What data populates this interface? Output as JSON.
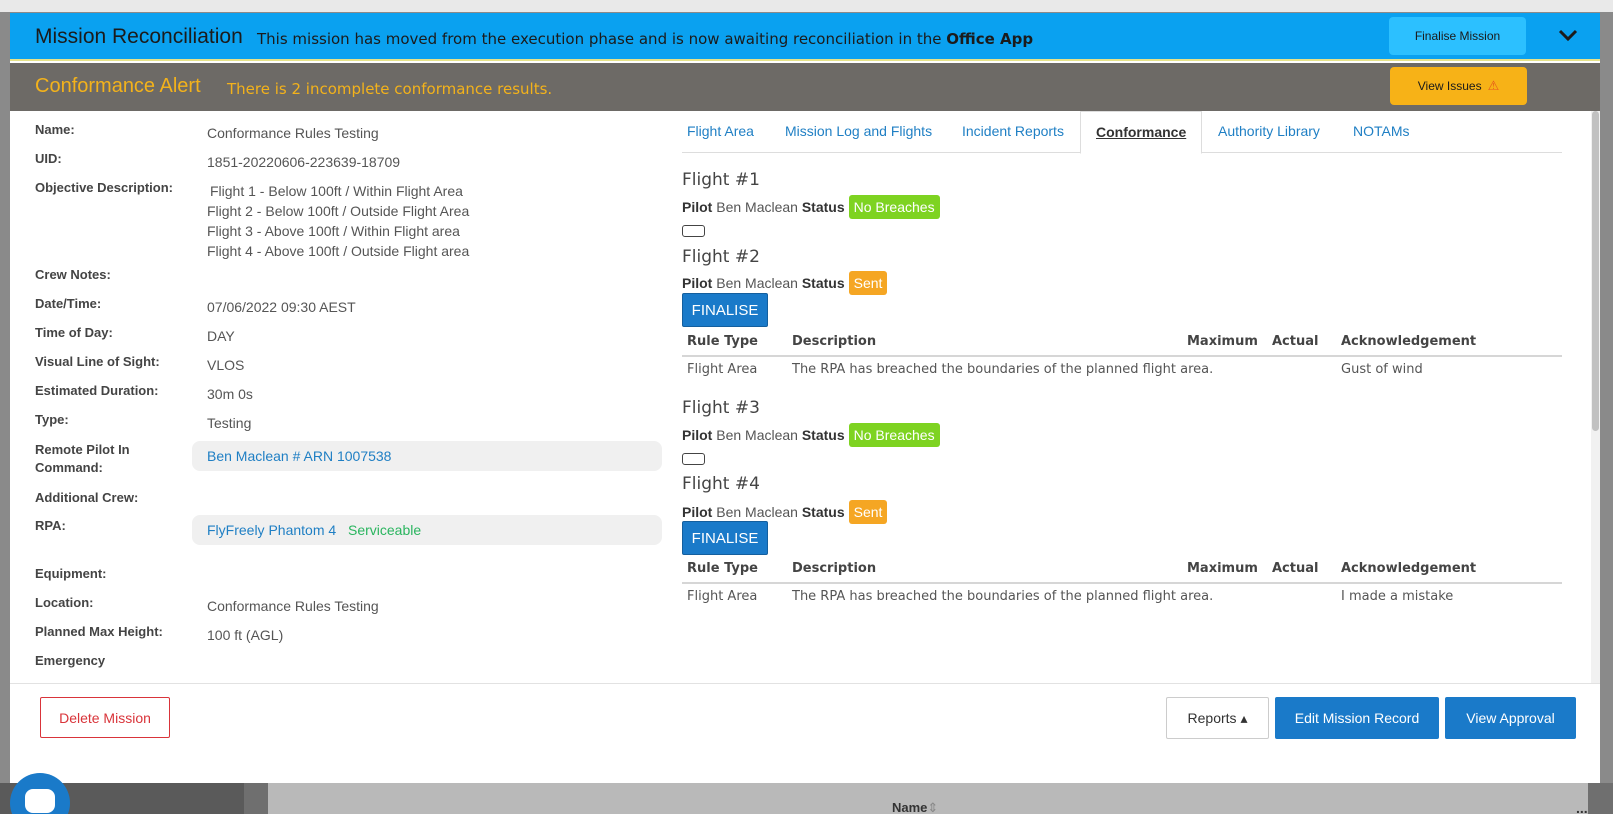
{
  "header": {
    "title": "Mission Reconciliation",
    "message_prefix": "This mission has moved from the execution phase and is now awaiting reconciliation in the ",
    "message_bold": "Office App",
    "finalise_label": "Finalise Mission"
  },
  "alert": {
    "title": "Conformance Alert",
    "message": "There is 2 incomplete conformance results.",
    "button_label": "View Issues",
    "warn_icon": "⚠"
  },
  "details": {
    "name_label": "Name:",
    "name_value": "Conformance Rules Testing",
    "uid_label": "UID:",
    "uid_value": "1851-20220606-223639-18709",
    "objective_label": "Objective Description:",
    "objective_lines": [
      "Flight 1 - Below 100ft / Within Flight Area",
      "Flight 2 - Below 100ft / Outside Flight Area",
      "Flight 3 - Above 100ft / Within Flight area",
      "Flight 4 - Above 100ft / Outside Flight area"
    ],
    "crew_notes_label": "Crew Notes:",
    "datetime_label": "Date/Time:",
    "datetime_value": "07/06/2022 09:30 AEST",
    "timeofday_label": "Time of Day:",
    "timeofday_value": "DAY",
    "vlos_label": "Visual Line of Sight:",
    "vlos_value": "VLOS",
    "duration_label": "Estimated Duration:",
    "duration_value": "30m 0s",
    "type_label": "Type:",
    "type_value": "Testing",
    "rpic_label": "Remote Pilot In Command:",
    "rpic_value": "Ben Maclean # ARN 1007538",
    "additional_crew_label": "Additional Crew:",
    "rpa_label": "RPA:",
    "rpa_name": "FlyFreely Phantom 4",
    "rpa_status": "Serviceable",
    "equipment_label": "Equipment:",
    "location_label": "Location:",
    "location_value": "Conformance Rules Testing",
    "maxheight_label": "Planned Max Height:",
    "maxheight_value": "100 ft (AGL)",
    "emergency_label": "Emergency"
  },
  "tabs": [
    "Flight Area",
    "Mission Log and Flights",
    "Incident Reports",
    "Conformance",
    "Authority Library",
    "NOTAMs"
  ],
  "conformance": {
    "pilot_label": "Pilot",
    "status_label": "Status",
    "finalise_label": "FINALISE",
    "columns": [
      "Rule Type",
      "Description",
      "Maximum",
      "Actual",
      "Acknowledgement"
    ],
    "flights": [
      {
        "title": "Flight #1",
        "pilot": "Ben Maclean",
        "status": "No Breaches"
      },
      {
        "title": "Flight #2",
        "pilot": "Ben Maclean",
        "status": "Sent",
        "row": {
          "rule_type": "Flight Area",
          "description": "The RPA has breached the boundaries of the planned flight area.",
          "maximum": "",
          "actual": "",
          "acknowledgement": "Gust of wind"
        }
      },
      {
        "title": "Flight #3",
        "pilot": "Ben Maclean",
        "status": "No Breaches"
      },
      {
        "title": "Flight #4",
        "pilot": "Ben Maclean",
        "status": "Sent",
        "row": {
          "rule_type": "Flight Area",
          "description": "The RPA has breached the boundaries of the planned flight area.",
          "maximum": "",
          "actual": "",
          "acknowledgement": "I made a mistake"
        }
      }
    ]
  },
  "footer": {
    "delete_label": "Delete Mission",
    "reports_label": "Reports ▴",
    "edit_label": "Edit Mission Record",
    "approval_label": "View Approval"
  },
  "background": {
    "name_header": "Name",
    "sort_icon": "⇕",
    "more_icon": "..."
  },
  "colors": {
    "header_blue": "#0aa1f0",
    "alert_bg": "#6d6a66",
    "alert_text": "#f3b21b",
    "primary": "#1a7ac9",
    "badge_green": "#7ed321",
    "badge_orange": "#f5a623",
    "danger": "#d9343a"
  }
}
